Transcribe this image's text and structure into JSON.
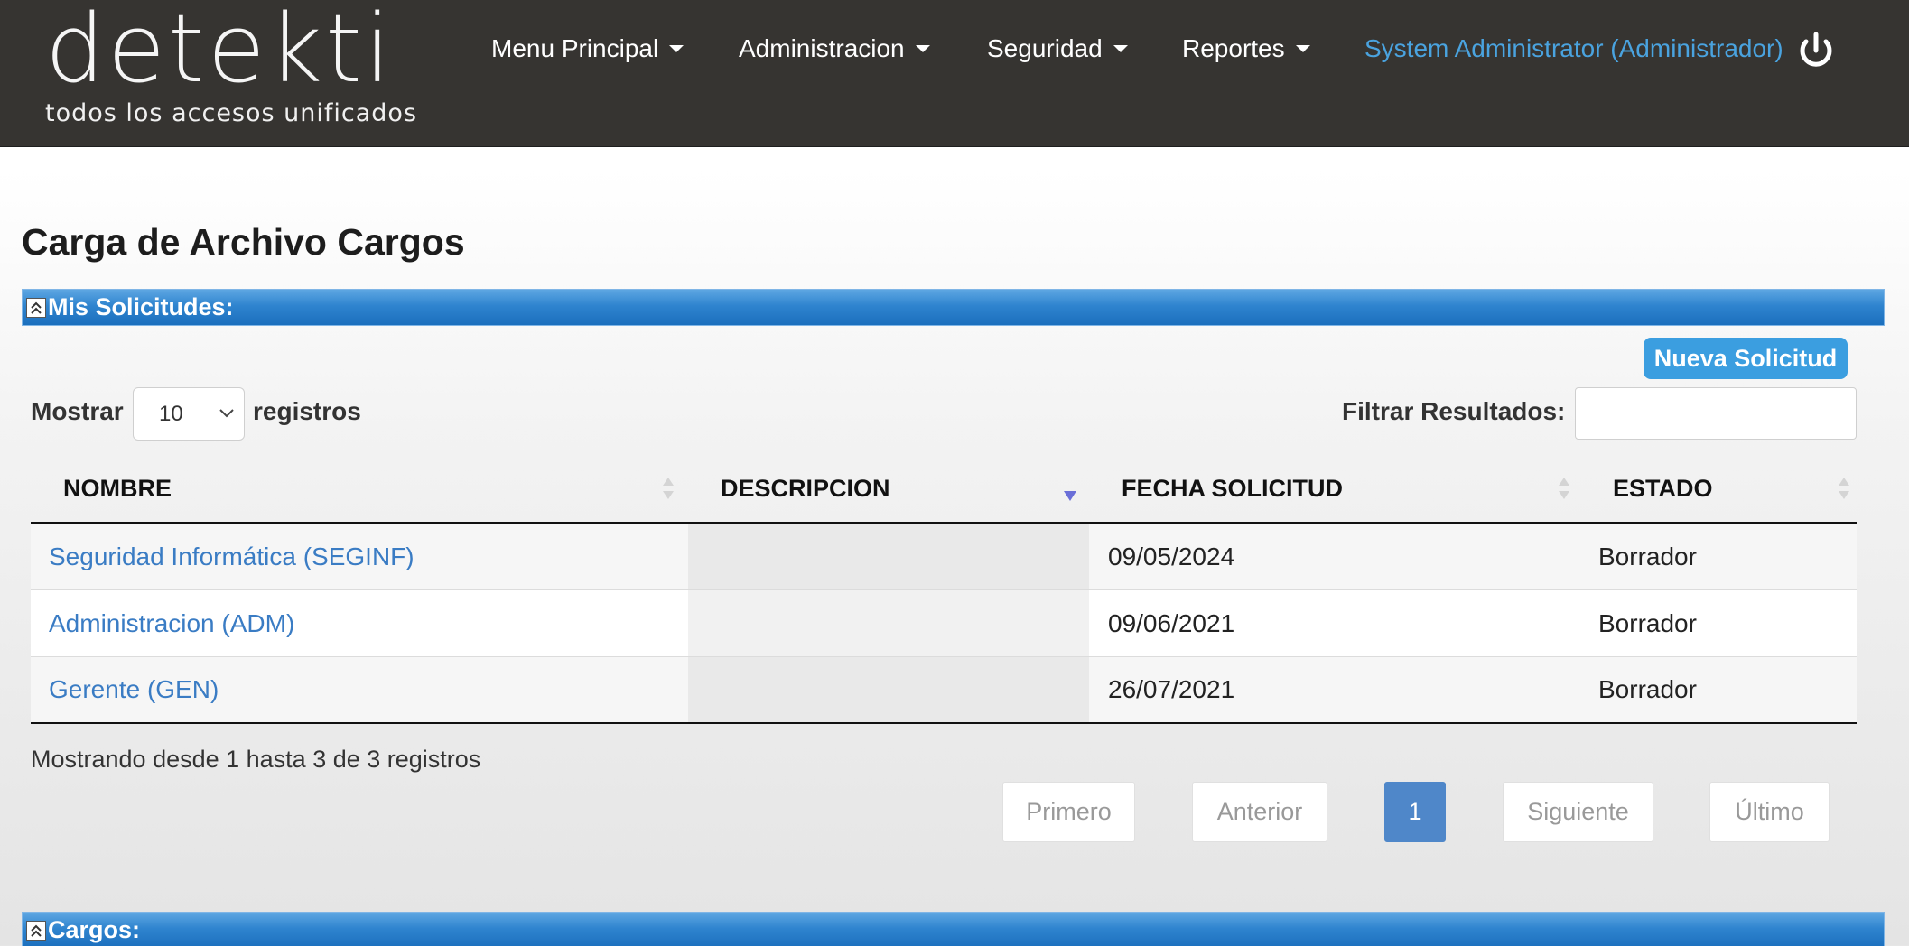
{
  "header": {
    "logo_word": "detekti",
    "logo_tagline": "todos los accesos unificados",
    "nav": [
      {
        "label": "Menu Principal"
      },
      {
        "label": "Administracion"
      },
      {
        "label": "Seguridad"
      },
      {
        "label": "Reportes"
      }
    ],
    "user": "System Administrator (Administrador)"
  },
  "page": {
    "title": "Carga de Archivo Cargos"
  },
  "requests_section": {
    "title": "Mis Solicitudes:",
    "new_button": "Nueva Solicitud",
    "show_label": "Mostrar",
    "show_value": "10",
    "records_label": "registros",
    "filter_label": "Filtrar Resultados:",
    "filter_value": "",
    "columns": [
      "NOMBRE",
      "DESCRIPCION",
      "FECHA SOLICITUD",
      "ESTADO"
    ],
    "sorted_column": "DESCRIPCION",
    "rows": [
      {
        "nombre": "Seguridad Informática (SEGINF)",
        "descripcion": "",
        "fecha": "09/05/2024",
        "estado": "Borrador"
      },
      {
        "nombre": "Administracion (ADM)",
        "descripcion": "",
        "fecha": "09/06/2021",
        "estado": "Borrador"
      },
      {
        "nombre": "Gerente (GEN)",
        "descripcion": "",
        "fecha": "26/07/2021",
        "estado": "Borrador"
      }
    ],
    "info": "Mostrando desde 1 hasta 3 de 3 registros",
    "pagination": {
      "first": "Primero",
      "prev": "Anterior",
      "current": "1",
      "next": "Siguiente",
      "last": "Último"
    }
  },
  "positions_section": {
    "title": "Cargos:"
  },
  "colors": {
    "navbar": "#363431",
    "accent": "#3b9ee0",
    "link": "#3a7cc4",
    "user_link": "#4aa3df",
    "active_page": "#4f87c9"
  }
}
